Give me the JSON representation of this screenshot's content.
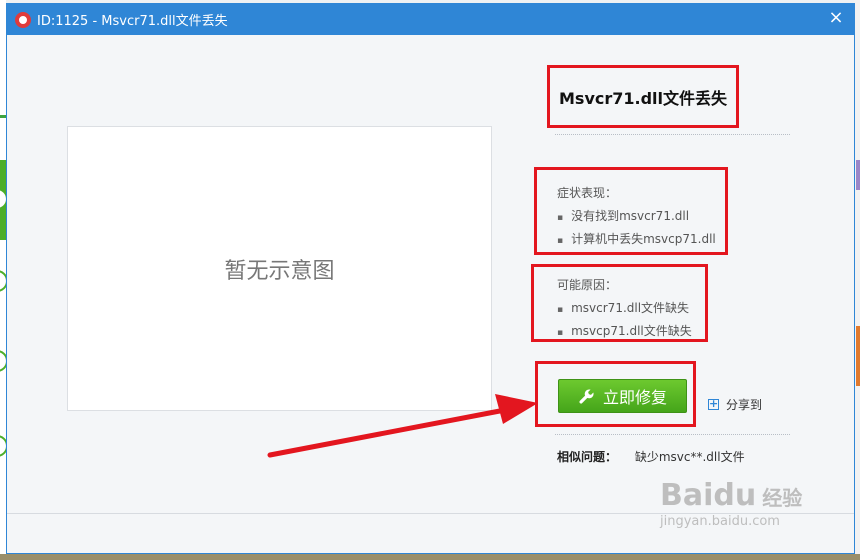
{
  "window": {
    "title": "ID:1125 - Msvcr71.dll文件丢失",
    "close_glyph": "×",
    "accent": "#2f86d6"
  },
  "preview": {
    "placeholder": "暂无示意图"
  },
  "issue": {
    "title": "Msvcr71.dll文件丢失"
  },
  "symptoms": {
    "label": "症状表现：",
    "items": [
      "没有找到msvcr71.dll",
      "计算机中丢失msvcp71.dll"
    ]
  },
  "causes": {
    "label": "可能原因：",
    "items": [
      "msvcr71.dll文件缺失",
      "msvcp71.dll文件缺失"
    ]
  },
  "actions": {
    "fix_label": "立即修复",
    "fix_icon": "wrench-icon",
    "share_label": "分享到",
    "share_icon": "plus-icon",
    "fix_color": "#4fb21f"
  },
  "similar": {
    "label": "相似问题：",
    "link": "缺少msvc**.dll文件"
  },
  "annotation": {
    "highlight_color": "#e3161f"
  },
  "watermark": {
    "logo": "Baidu",
    "suffix": "经验",
    "url": "jingyan.baidu.com"
  }
}
